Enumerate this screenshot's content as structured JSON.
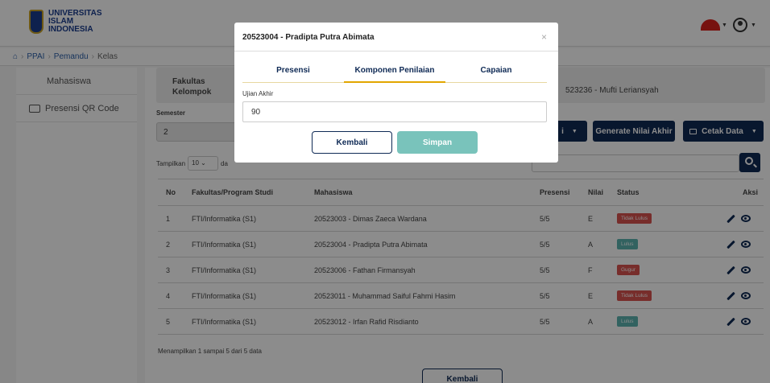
{
  "header": {
    "logo_text": [
      "UNIVERSITAS",
      "ISLAM",
      "INDONESIA"
    ]
  },
  "breadcrumb": [
    "PPAI",
    "Pemandu",
    "Kelas"
  ],
  "sidebar": {
    "items": [
      {
        "label": "Mahasiswa"
      },
      {
        "label": "Presensi QR Code"
      }
    ]
  },
  "info": {
    "fakultas_label": "Fakultas",
    "kelompok_label": "Kelompok",
    "dosen": "523236 - Mufti Leriansyah"
  },
  "semester": {
    "label": "Semester",
    "value": "2"
  },
  "actions": {
    "partial": "i",
    "generate": "Generate Nilai Akhir",
    "cetak": "Cetak Data"
  },
  "tampilkan": {
    "label": "Tampilkan",
    "value": "10",
    "suffix": "da"
  },
  "table": {
    "headers": [
      "No",
      "Fakultas/Program Studi",
      "Mahasiswa",
      "Presensi",
      "Nilai",
      "Status",
      "Aksi"
    ],
    "rows": [
      {
        "no": "1",
        "fakultas": "FTI/Informatika (S1)",
        "mahasiswa": "20523003 - Dimas Zaeca Wardana",
        "presensi": "5/5",
        "nilai": "E",
        "status": "Tidak Lulus",
        "status_color": "#d9534f"
      },
      {
        "no": "2",
        "fakultas": "FTI/Informatika (S1)",
        "mahasiswa": "20523004 - Pradipta Putra Abimata",
        "presensi": "5/5",
        "nilai": "A",
        "status": "Lulus",
        "status_color": "#5bb3b0"
      },
      {
        "no": "3",
        "fakultas": "FTI/Informatika (S1)",
        "mahasiswa": "20523006 - Fathan Firmansyah",
        "presensi": "5/5",
        "nilai": "F",
        "status": "Gugur",
        "status_color": "#d9534f"
      },
      {
        "no": "4",
        "fakultas": "FTI/Informatika (S1)",
        "mahasiswa": "20523011 - Muhammad Saiful Fahmi Hasim",
        "presensi": "5/5",
        "nilai": "E",
        "status": "Tidak Lulus",
        "status_color": "#d9534f"
      },
      {
        "no": "5",
        "fakultas": "FTI/Informatika (S1)",
        "mahasiswa": "20523012 - Irfan Rafid Risdianto",
        "presensi": "5/5",
        "nilai": "A",
        "status": "Lulus",
        "status_color": "#5bb3b0"
      }
    ]
  },
  "footer": {
    "info": "Menampilkan 1 sampai 5 dari 5 data",
    "kembali": "Kembali"
  },
  "modal": {
    "title": "20523004 - Pradipta Putra Abimata",
    "close": "×",
    "tabs": [
      "Presensi",
      "Komponen Penilaian",
      "Capaian"
    ],
    "field_label": "Ujian Akhir",
    "field_value": "90",
    "kembali": "Kembali",
    "simpan": "Simpan"
  }
}
